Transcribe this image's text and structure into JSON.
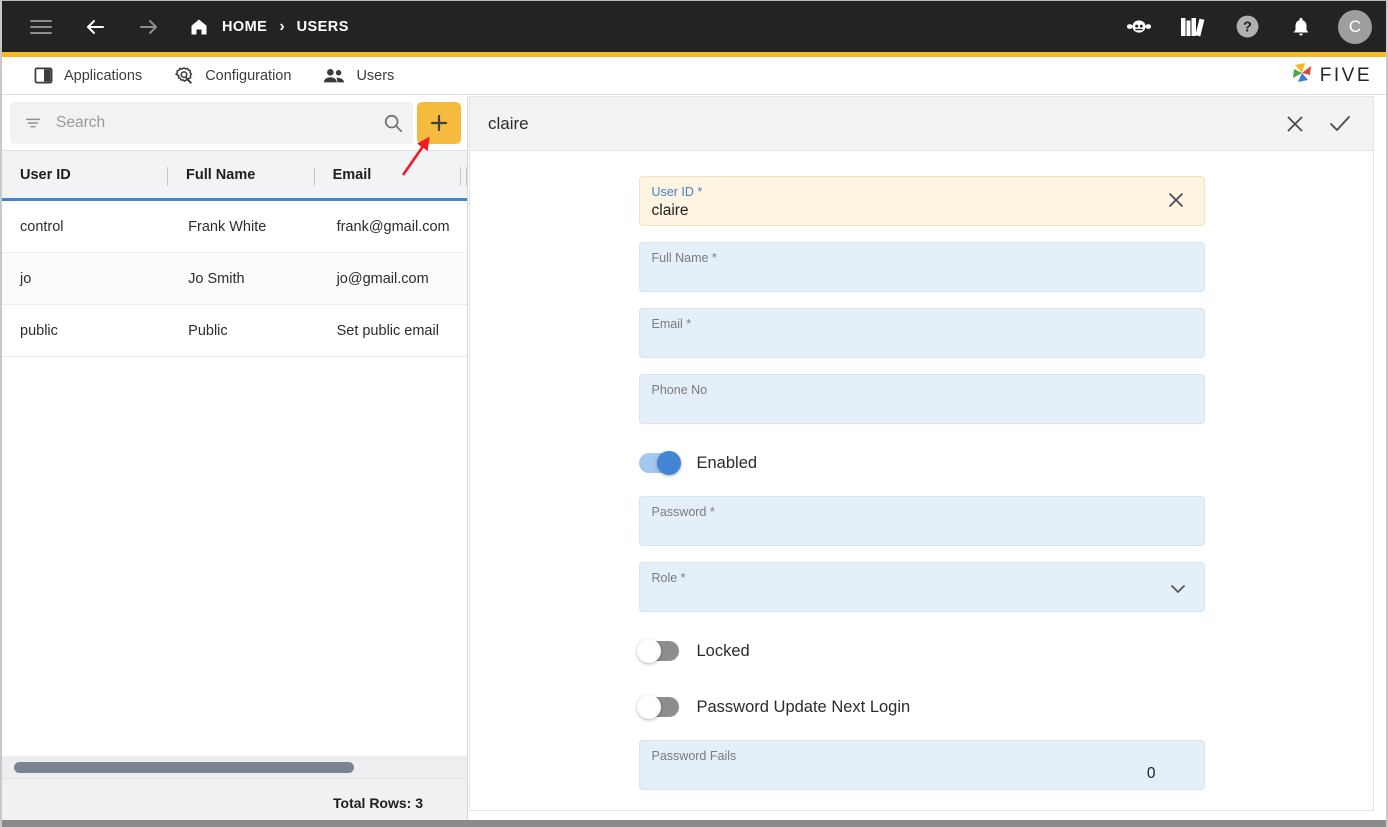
{
  "topbar": {
    "menu_icon": "hamburger-icon",
    "back_icon": "arrow-left-icon",
    "forward_icon": "arrow-right-icon",
    "home_icon": "home-icon",
    "breadcrumb": [
      "HOME",
      "USERS"
    ],
    "separator": "›",
    "right_icons": [
      "chat-bot-icon",
      "library-books-icon",
      "help-icon",
      "bell-icon"
    ],
    "avatar_initial": "C",
    "bg_color": "#232323",
    "accent_color": "#f7b925"
  },
  "tabs": [
    {
      "label": "Applications",
      "icon": "applications-icon"
    },
    {
      "label": "Configuration",
      "icon": "configuration-gear-icon"
    },
    {
      "label": "Users",
      "icon": "users-people-icon"
    }
  ],
  "logo": {
    "text": "FIVE",
    "icon": "five-pinwheel-logo"
  },
  "left_panel": {
    "search": {
      "placeholder": "Search",
      "value": "",
      "filter_icon": "filter-icon",
      "search_icon": "search-icon"
    },
    "add_button": {
      "label": "+",
      "icon": "plus-icon",
      "color": "#f5bb3e"
    },
    "grid": {
      "columns": [
        "User ID",
        "Full Name",
        "Email"
      ],
      "rows": [
        {
          "user_id": "control",
          "full_name": "Frank White",
          "email": "frank@gmail.com"
        },
        {
          "user_id": "jo",
          "full_name": "Jo Smith",
          "email": "jo@gmail.com"
        },
        {
          "user_id": "public",
          "full_name": "Public",
          "email": "Set public email"
        }
      ],
      "footer": "Total Rows: 3"
    }
  },
  "detail": {
    "title": "claire",
    "close_icon": "close-x-icon",
    "confirm_icon": "checkmark-icon",
    "fields": [
      {
        "label": "User ID *",
        "value": "claire",
        "focused": true,
        "clear_icon": "clear-x-icon"
      },
      {
        "label": "Full Name *",
        "value": ""
      },
      {
        "label": "Email *",
        "value": ""
      },
      {
        "label": "Phone No",
        "value": ""
      }
    ],
    "enabled_toggle": {
      "label": "Enabled",
      "state": "on"
    },
    "password_field": {
      "label": "Password *",
      "value": ""
    },
    "role_field": {
      "label": "Role *",
      "value": "",
      "chevron_icon": "chevron-down-icon"
    },
    "locked_toggle": {
      "label": "Locked",
      "state": "off"
    },
    "password_update_toggle": {
      "label": "Password Update Next Login",
      "state": "off"
    },
    "password_fails_field": {
      "label": "Password Fails",
      "value": "0"
    }
  },
  "annotation": {
    "type": "red-arrow",
    "points_to": "add-button",
    "color": "#ee1c25"
  }
}
